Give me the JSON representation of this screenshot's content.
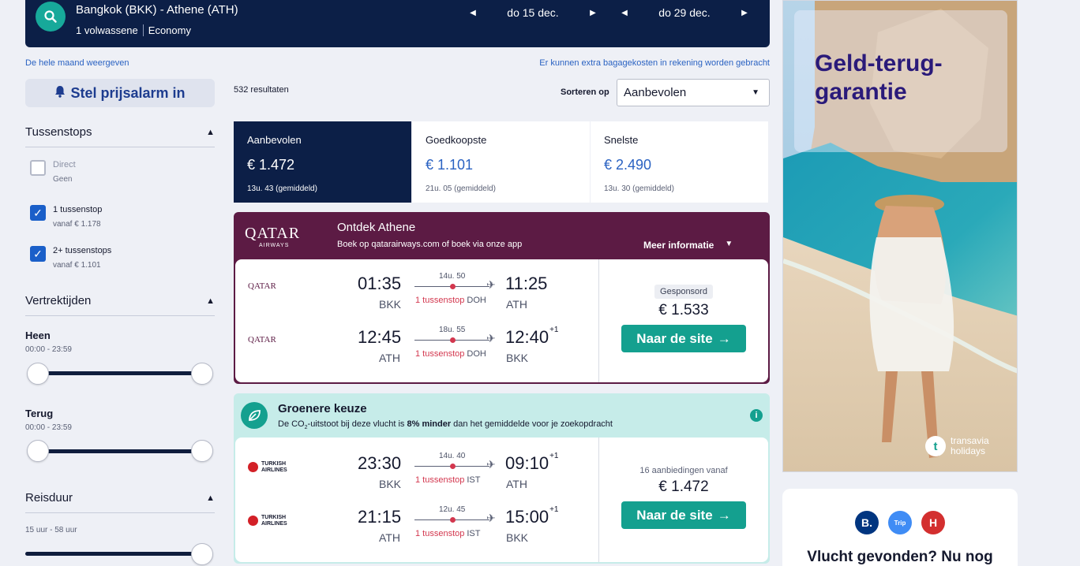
{
  "search": {
    "route": "Bangkok (BKK) - Athene (ATH)",
    "passengers": "1 volwassene",
    "cabin": "Economy",
    "depart_date": "do 15 dec.",
    "return_date": "do 29 dec."
  },
  "links": {
    "whole_month": "De hele maand weergeven",
    "baggage": "Er kunnen extra bagagekosten in rekening worden gebracht"
  },
  "alarm": {
    "label": "Stel prijsalarm in"
  },
  "filters": {
    "stops": {
      "title": "Tussenstops",
      "items": [
        {
          "label": "Direct",
          "sub": "Geen",
          "checked": false
        },
        {
          "label": "1 tussenstop",
          "sub": "vanaf € 1.178",
          "checked": true
        },
        {
          "label": "2+ tussenstops",
          "sub": "vanaf € 1.101",
          "checked": true
        }
      ]
    },
    "times": {
      "title": "Vertrektijden",
      "out_label": "Heen",
      "out_range": "00:00 - 23:59",
      "ret_label": "Terug",
      "ret_range": "00:00 - 23:59"
    },
    "duration": {
      "title": "Reisduur",
      "range": "15 uur - 58 uur"
    }
  },
  "results": {
    "count": "532 resultaten",
    "sort_label": "Sorteren op",
    "sort_value": "Aanbevolen"
  },
  "sort_tabs": [
    {
      "label": "Aanbevolen",
      "price": "€ 1.472",
      "duration": "13u. 43 (gemiddeld)"
    },
    {
      "label": "Goedkoopste",
      "price": "€ 1.101",
      "duration": "21u. 05 (gemiddeld)"
    },
    {
      "label": "Snelste",
      "price": "€ 2.490",
      "duration": "13u. 30 (gemiddeld)"
    }
  ],
  "qatar": {
    "logo_text": "QATAR",
    "logo_sub": "AIRWAYS",
    "headline": "Ontdek Athene",
    "sub": "Boek op qatarairways.com of boek via onze app",
    "more": "Meer informatie",
    "legs": [
      {
        "airline": "QATAR",
        "dep": "01:35",
        "arr": "11:25",
        "arr_plus": "",
        "from": "BKK",
        "to": "ATH",
        "duration": "14u. 50",
        "stops": "1 tussenstop",
        "via": "DOH"
      },
      {
        "airline": "QATAR",
        "dep": "12:45",
        "arr": "12:40",
        "arr_plus": "+1",
        "from": "ATH",
        "to": "BKK",
        "duration": "18u. 55",
        "stops": "1 tussenstop",
        "via": "DOH"
      }
    ],
    "sponsored": "Gesponsord",
    "price": "€ 1.533",
    "button": "Naar de site"
  },
  "green": {
    "title": "Groenere keuze",
    "desc_pre": "De CO",
    "desc_sub": "2",
    "desc_mid": "-uitstoot bij deze vlucht is ",
    "desc_bold": "8% minder",
    "desc_post": " dan het gemiddelde voor je zoekopdracht",
    "legs": [
      {
        "airline": "TURKISH AIRLINES",
        "dep": "23:30",
        "arr": "09:10",
        "arr_plus": "+1",
        "from": "BKK",
        "to": "ATH",
        "duration": "14u. 40",
        "stops": "1 tussenstop",
        "via": "IST"
      },
      {
        "airline": "TURKISH AIRLINES",
        "dep": "21:15",
        "arr": "15:00",
        "arr_plus": "+1",
        "from": "ATH",
        "to": "BKK",
        "duration": "12u. 45",
        "stops": "1 tussenstop",
        "via": "IST"
      }
    ],
    "offers": "16 aanbiedingen vanaf",
    "price": "€ 1.472",
    "button": "Naar de site"
  },
  "ad": {
    "title": "Geld-terug-garantie",
    "brand": "transavia",
    "brand_sub": "holidays"
  },
  "ad2": {
    "badges": [
      "B.",
      "Trip",
      "H"
    ],
    "text": "Vlucht gevonden? Nu nog"
  },
  "colors": {
    "navy": "#0c1f47",
    "teal": "#14a08f",
    "qatar": "#5c1b44",
    "green_bg": "#c6ece9",
    "blue_link": "#2a62c2"
  }
}
